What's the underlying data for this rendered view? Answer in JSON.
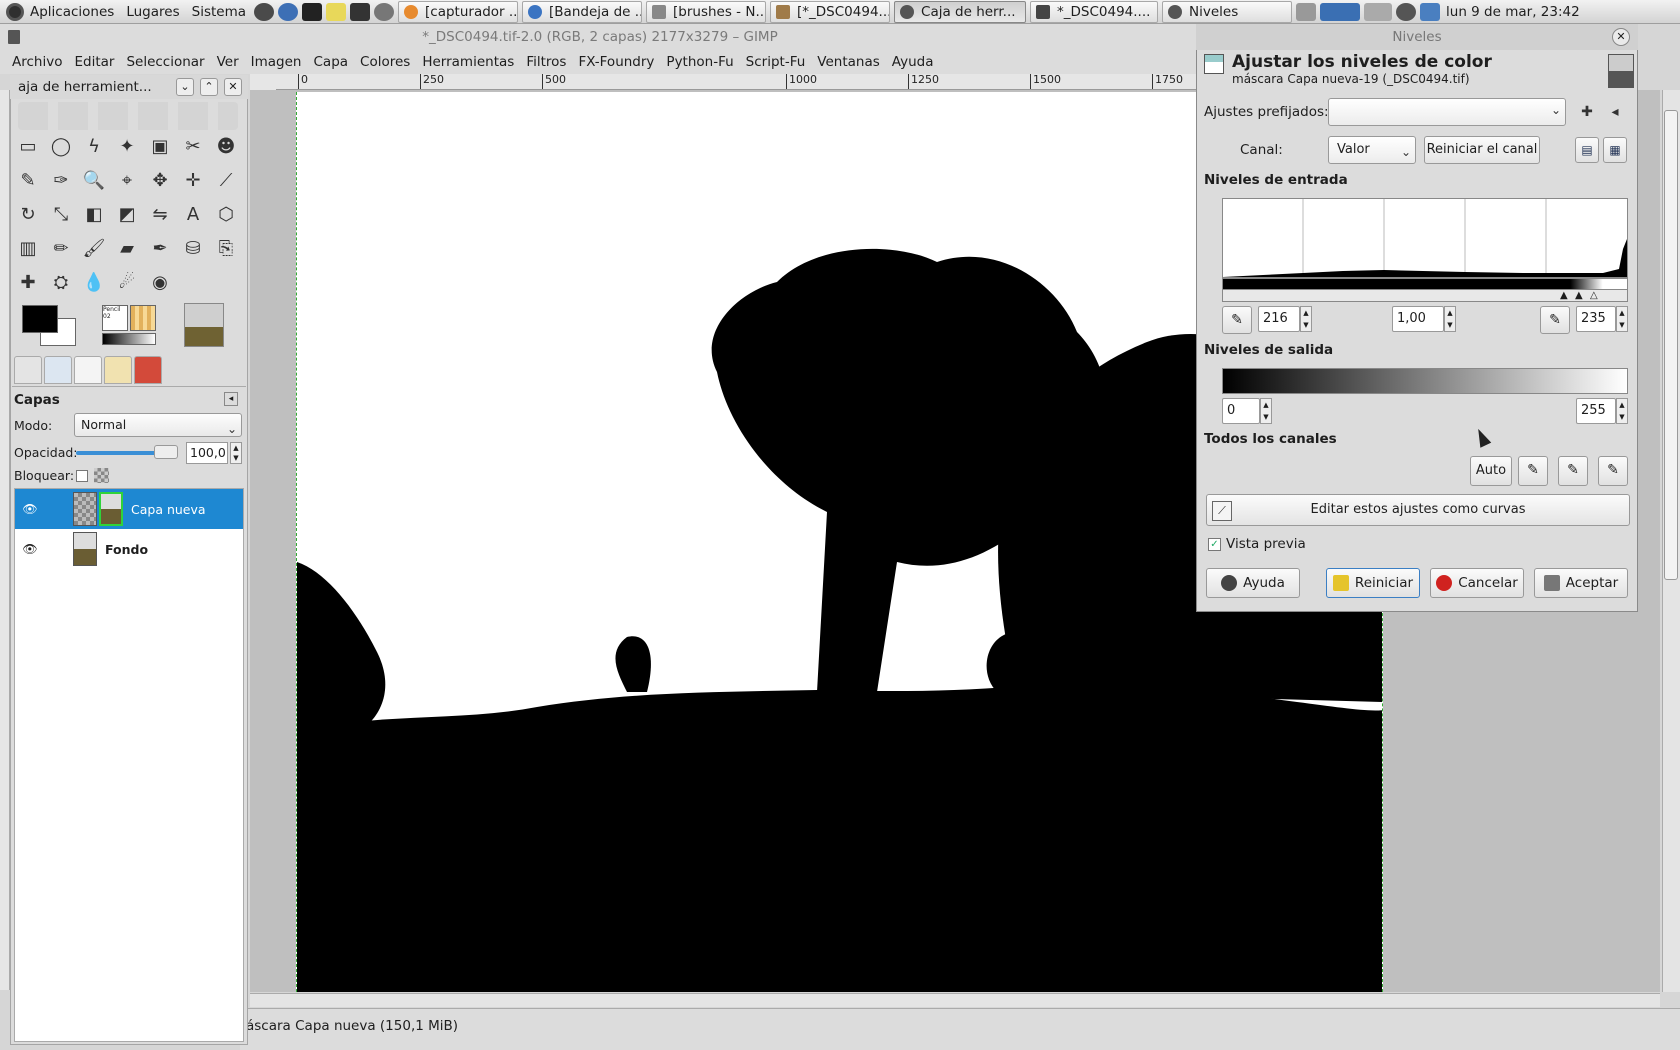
{
  "top_panel": {
    "menu": [
      "Aplicaciones",
      "Lugares",
      "Sistema"
    ],
    "tasks": [
      {
        "label": "[capturador ...",
        "active": false
      },
      {
        "label": "[Bandeja de ...",
        "active": false
      },
      {
        "label": "[brushes - N...",
        "active": false
      },
      {
        "label": "[*_DSC0494...",
        "active": false
      },
      {
        "label": "Caja de herr...",
        "active": true
      },
      {
        "label": "*_DSC0494....",
        "active": false
      },
      {
        "label": "Niveles",
        "active": false
      }
    ],
    "clock": "lun  9 de mar, 23:42"
  },
  "gimp": {
    "title": "*_DSC0494.tif-2.0 (RGB, 2 capas) 2177x3279 – GIMP",
    "menu": [
      "Archivo",
      "Editar",
      "Seleccionar",
      "Ver",
      "Imagen",
      "Capa",
      "Colores",
      "Herramientas",
      "Filtros",
      "FX-Foundry",
      "Python-Fu",
      "Script-Fu",
      "Ventanas",
      "Ayuda"
    ],
    "ruler_ticks": [
      "0",
      "250",
      "500",
      "1000",
      "1250",
      "1500",
      "1750"
    ],
    "status": "áscara Capa nueva (150,1 MiB)"
  },
  "toolbox": {
    "title": "aja de herramient...",
    "tools": [
      "rect-select",
      "ellipse-select",
      "free-select",
      "fuzzy-select",
      "color-select",
      "scissors",
      "foreground-select",
      "paths",
      "color-picker",
      "zoom",
      "measure",
      "move",
      "align",
      "crop",
      "rotate",
      "scale",
      "shear",
      "perspective",
      "flip",
      "text",
      "cage",
      "blend",
      "pencil",
      "paintbrush",
      "eraser",
      "airbrush",
      "ink",
      "clone",
      "heal",
      "perspective-clone",
      "blur",
      "smudge",
      "dodge-burn"
    ],
    "tool_glyphs": [
      "▭",
      "◯",
      "ϟ",
      "✦",
      "▣",
      "✂",
      "☻",
      "✎",
      "✑",
      "🔍",
      "⌖",
      "✥",
      "✛",
      "⟋",
      "↻",
      "⤡",
      "◧",
      "◩",
      "⇋",
      "A",
      "⬡",
      "▥",
      "✏",
      "🖌",
      "▰",
      "✒",
      "⛁",
      "⎘",
      "✚",
      "⛭",
      "💧",
      "☄",
      "◉"
    ],
    "brush_label": "Pencil 02"
  },
  "layers": {
    "header": "Capas",
    "mode_label": "Modo:",
    "mode_value": "Normal",
    "opacity_label": "Opacidad:",
    "opacity_value": "100,0",
    "opacity_fraction": 1.0,
    "lock_label": "Bloquear:",
    "items": [
      {
        "name": "Capa nueva",
        "selected": true
      },
      {
        "name": "Fondo",
        "selected": false
      }
    ]
  },
  "levels": {
    "window_title": "Niveles",
    "heading": "Ajustar los niveles de color",
    "subheading": "máscara Capa nueva-19 (_DSC0494.tif)",
    "presets_label": "Ajustes prefijados:",
    "presets_value": "",
    "channel_label": "Canal:",
    "channel_value": "Valor",
    "reset_channel": "Reiniciar el canal",
    "input_section": "Niveles de entrada",
    "input_low": "216",
    "input_gamma": "1,00",
    "input_high": "235",
    "output_section": "Niveles de salida",
    "output_low": "0",
    "output_high": "255",
    "all_channels": "Todos los canales",
    "auto": "Auto",
    "edit_curves": "Editar estos ajustes como curvas",
    "preview_label": "Vista previa",
    "preview_checked": true,
    "buttons": {
      "help": "Ayuda",
      "reset": "Reiniciar",
      "cancel": "Cancelar",
      "ok": "Aceptar"
    }
  }
}
